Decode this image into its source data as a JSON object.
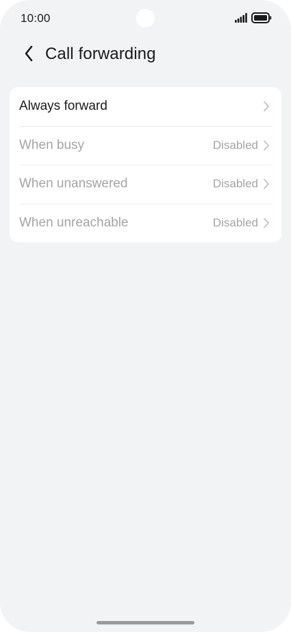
{
  "status_bar": {
    "time": "10:00",
    "signal_icon": "signal-icon",
    "battery_icon": "battery-icon"
  },
  "header": {
    "back_icon": "chevron-left-icon",
    "title": "Call forwarding"
  },
  "settings": {
    "items": [
      {
        "label": "Always forward",
        "value": "",
        "enabled": true
      },
      {
        "label": "When busy",
        "value": "Disabled",
        "enabled": false
      },
      {
        "label": "When unanswered",
        "value": "Disabled",
        "enabled": false
      },
      {
        "label": "When unreachable",
        "value": "Disabled",
        "enabled": false
      }
    ]
  },
  "colors": {
    "background": "#f2f3f5",
    "card": "#ffffff",
    "text_primary": "#1a1a1a",
    "text_disabled": "#a4a4a8"
  }
}
